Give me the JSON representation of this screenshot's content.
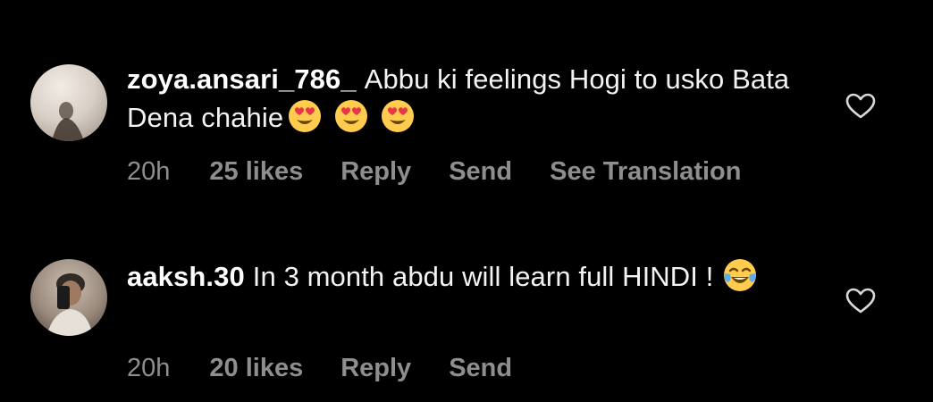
{
  "comments": [
    {
      "username": "zoya.ansari_786_",
      "text": "Abbu ki feelings Hogi to usko Bata Dena chahie",
      "emojis": [
        "heart-eyes-emoji",
        "heart-eyes-emoji",
        "heart-eyes-emoji"
      ],
      "time": "20h",
      "likes": "25 likes",
      "reply_label": "Reply",
      "send_label": "Send",
      "translation_label": "See Translation",
      "like_icon": "heart-outline-icon"
    },
    {
      "username": "aaksh.30",
      "text": "In 3 month abdu will learn full HINDI !",
      "emojis": [
        "tears-of-joy-emoji"
      ],
      "time": "20h",
      "likes": "20 likes",
      "reply_label": "Reply",
      "send_label": "Send",
      "like_icon": "heart-outline-icon"
    }
  ],
  "colors": {
    "background": "#000000",
    "primary_text": "#f3f3f3",
    "secondary_text": "#8e8e8e"
  }
}
